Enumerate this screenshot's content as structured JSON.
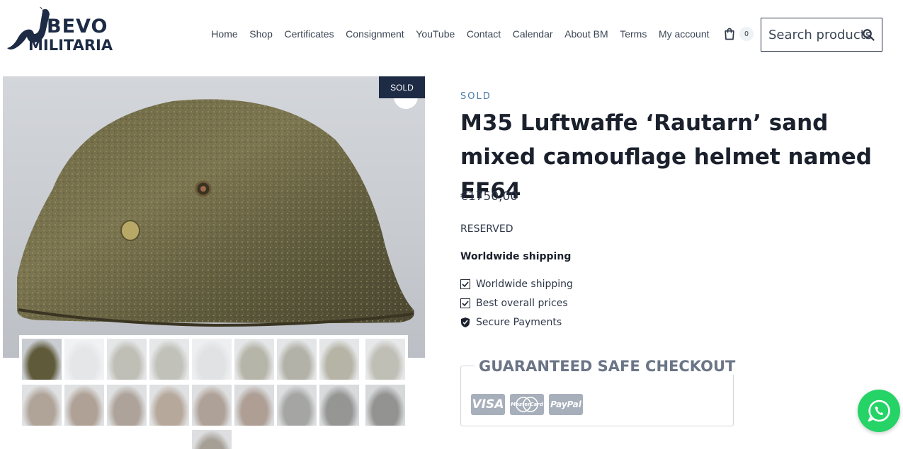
{
  "header": {
    "logo_line1": "BEVO",
    "logo_line2": "MILITARIA",
    "nav": [
      "Home",
      "Shop",
      "Certificates",
      "Consignment",
      "YouTube",
      "Contact",
      "Calendar",
      "About BM",
      "Terms",
      "My account"
    ],
    "cart_count": "0",
    "search_placeholder": "Search products"
  },
  "gallery": {
    "sold_badge": "SOLD",
    "thumbnail_count": 19
  },
  "product": {
    "status": "SOLD",
    "title": "M35 Luftwaffe ‘Rautarn’ sand mixed camouflage helmet named EF64",
    "price": "€1750,00",
    "availability": "RESERVED",
    "shipping_heading": "Worldwide shipping",
    "features": [
      "Worldwide shipping",
      "Best overall prices",
      "Secure Payments"
    ]
  },
  "checkout": {
    "title": "GUARANTEED SAFE CHECKOUT",
    "cards": [
      "VISA",
      "MasterCard",
      "PayPal"
    ]
  },
  "colors": {
    "navy": "#1d2b45",
    "accent_blue": "#4a7aa8",
    "whatsapp_green": "#25d366"
  }
}
